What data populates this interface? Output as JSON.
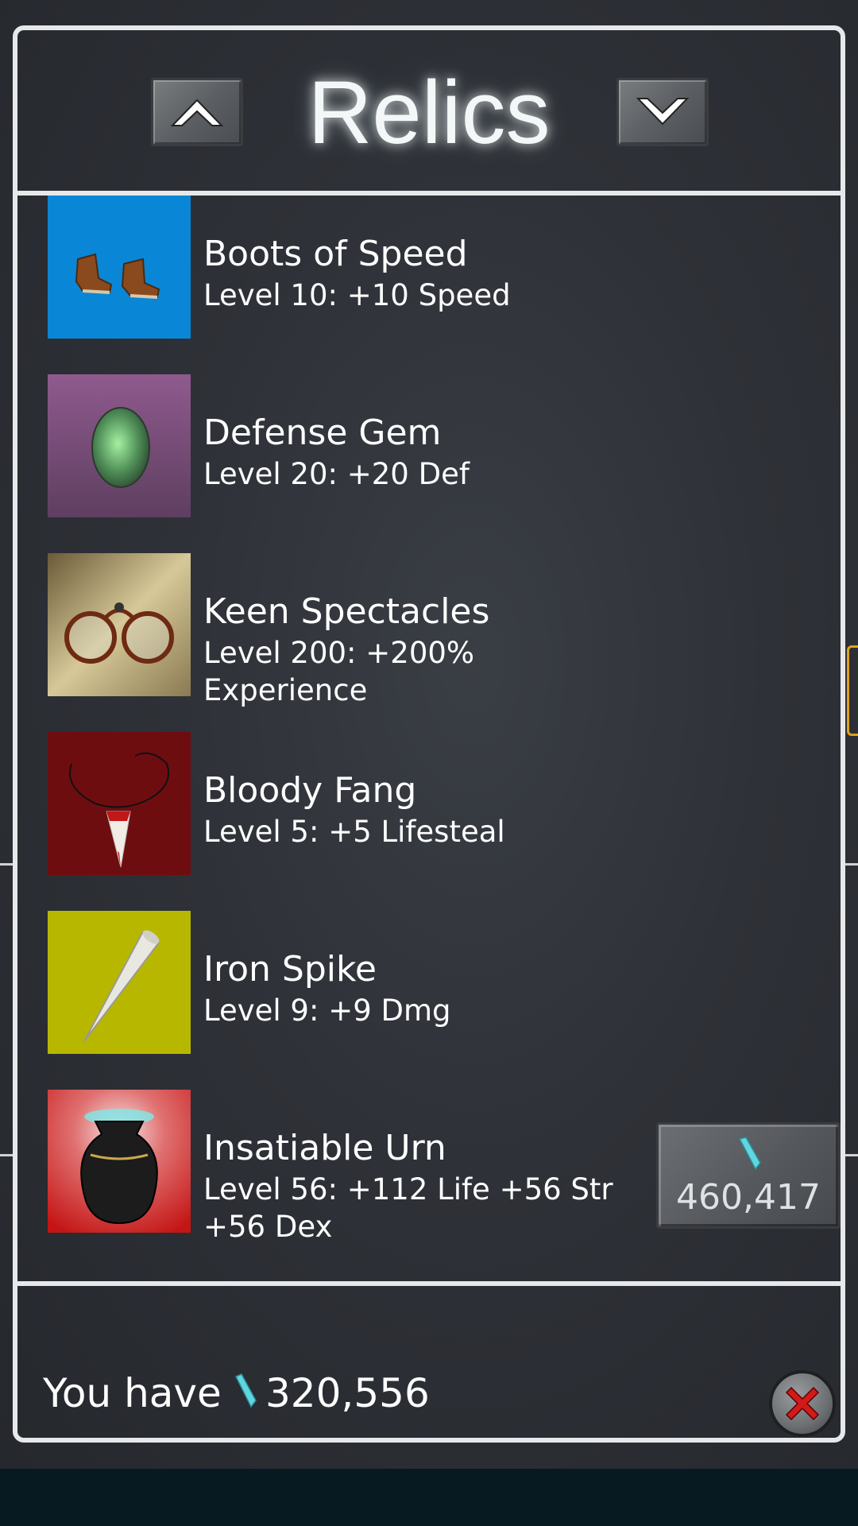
{
  "header": {
    "title": "Relics",
    "scroll_up_icon": "chevron-up-icon",
    "scroll_down_icon": "chevron-down-icon"
  },
  "relics": [
    {
      "name": "Boots of Speed",
      "description": "Level 10: +10 Speed",
      "icon": "boots-icon",
      "bg": "#0a86d6"
    },
    {
      "name": "Defense Gem",
      "description": "Level 20: +20 Def",
      "icon": "gem-icon",
      "bg": "#7c4f7a"
    },
    {
      "name": "Keen Spectacles",
      "description": "Level 200: +200% Experience",
      "icon": "spectacles-icon",
      "bg": "#a89466"
    },
    {
      "name": "Bloody Fang",
      "description": "Level 5: +5 Lifesteal",
      "icon": "fang-icon",
      "bg": "#6e0d10"
    },
    {
      "name": "Iron Spike",
      "description": "Level 9: +9 Dmg",
      "icon": "spike-icon",
      "bg": "#b8b700"
    },
    {
      "name": "Insatiable Urn",
      "description": "Level 56: +112 Life +56 Str +56 Dex",
      "icon": "urn-icon",
      "bg": "#c41414"
    }
  ],
  "upgrade": {
    "price": "460,417",
    "currency_icon": "crystal-icon"
  },
  "footer": {
    "label": "You have",
    "balance": "320,556",
    "currency_icon": "crystal-icon",
    "close_icon": "close-icon"
  },
  "colors": {
    "crystal": "#5fd6e0",
    "frame": "#e6e8ea",
    "close_x": "#d11a1a"
  }
}
